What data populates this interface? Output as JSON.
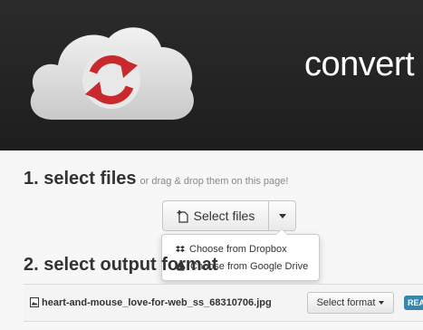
{
  "header": {
    "brand": "convert"
  },
  "step1": {
    "title": "1. select files",
    "hint": "or drag & drop them on this page!"
  },
  "select_button": {
    "label": "Select files"
  },
  "dropdown": {
    "items": [
      {
        "label": "Choose from Dropbox",
        "icon": "dropbox-icon"
      },
      {
        "label": "Choose from Google Drive",
        "icon": "google-drive-icon"
      }
    ]
  },
  "step2": {
    "title": "2. select output format"
  },
  "file": {
    "name": "heart-and-mouse_love-for-web_ss_68310706.jpg",
    "format_button": "Select format",
    "status": "READY"
  },
  "colors": {
    "header_bg": "#1e1e1e",
    "cloud": "#d8d8d8",
    "logo_red": "#c9282d",
    "badge": "#3a87ad"
  }
}
